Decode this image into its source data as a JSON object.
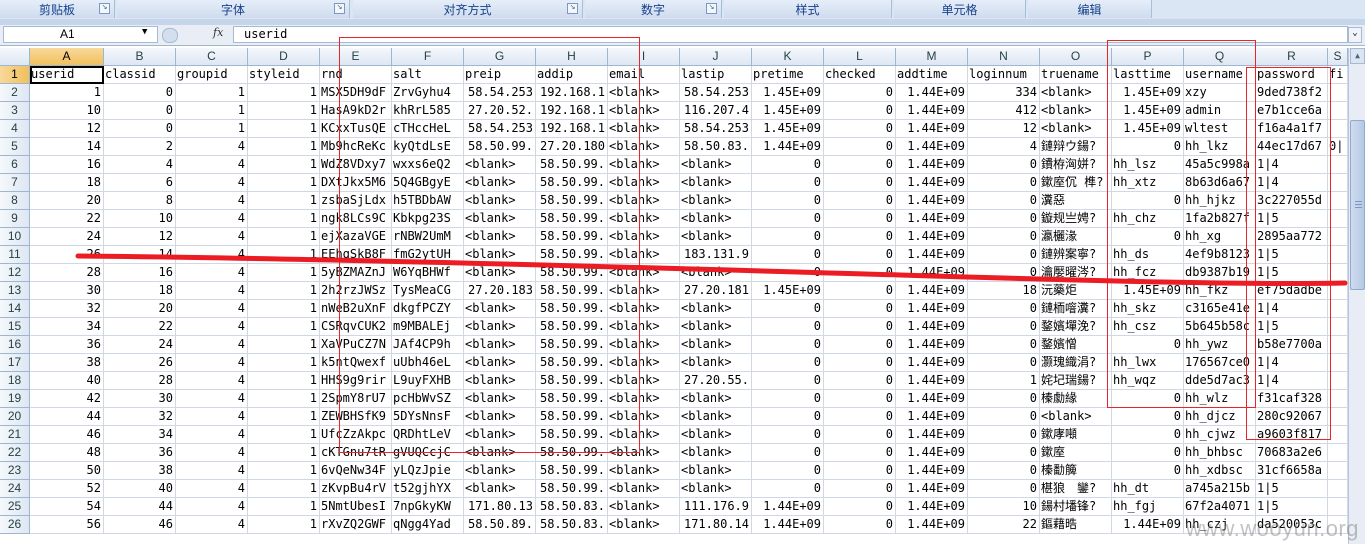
{
  "ribbon": {
    "groups": [
      "剪贴板",
      "字体",
      "对齐方式",
      "数字",
      "样式",
      "单元格",
      "编辑"
    ]
  },
  "formula_bar": {
    "name_box": "A1",
    "fx_label": "fx",
    "content": "userid"
  },
  "columns": [
    "A",
    "B",
    "C",
    "D",
    "E",
    "F",
    "G",
    "H",
    "I",
    "J",
    "K",
    "L",
    "M",
    "N",
    "O",
    "P",
    "Q",
    "R",
    "S"
  ],
  "rows": [
    [
      "userid",
      "classid",
      "groupid",
      "styleid",
      "rnd",
      "salt",
      "preip",
      "addip",
      "email",
      "lastip",
      "pretime",
      "checked",
      "addtime",
      "loginnum",
      "truename",
      "lasttime",
      "username",
      "password",
      "fi"
    ],
    [
      "1",
      "0",
      "1",
      "1",
      "MSX5DH9dF",
      "ZrvGyhu4",
      "58.54.253",
      "192.168.1",
      "<blank>",
      "58.54.253",
      "1.45E+09",
      "0",
      "1.44E+09",
      "334",
      "<blank>",
      "1.45E+09",
      "xzy",
      "9ded738f2",
      ""
    ],
    [
      "10",
      "0",
      "1",
      "1",
      "HasA9kD2r",
      "khRrL585",
      "27.20.52.",
      "192.168.1",
      "<blank>",
      "116.207.4",
      "1.45E+09",
      "0",
      "1.44E+09",
      "412",
      "<blank>",
      "1.45E+09",
      "admin",
      "e7b1cce6a",
      ""
    ],
    [
      "12",
      "0",
      "1",
      "1",
      "KCxxTusQE",
      "cTHccHeL",
      "58.54.253",
      "192.168.1",
      "<blank>",
      "58.54.253",
      "1.45E+09",
      "0",
      "1.44E+09",
      "12",
      "<blank>",
      "1.45E+09",
      "wltest",
      "f16a4a1f7",
      ""
    ],
    [
      "14",
      "2",
      "4",
      "1",
      "Mb9hcReKc",
      "kyQtdLsE",
      "58.50.99.",
      "27.20.180",
      "<blank>",
      "58.50.83.",
      "1.44E+09",
      "0",
      "1.44E+09",
      "4",
      "鏈辩ウ鍚?",
      "0",
      "hh_lkz",
      "44ec17d67",
      "0|"
    ],
    [
      "16",
      "4",
      "4",
      "1",
      "WdZ8VDxy7",
      "wxxs6eQ2",
      "<blank>",
      "58.50.99.",
      "<blank>",
      "<blank>",
      "0",
      "0",
      "1.44E+09",
      "0",
      "鐨栫洶姘?",
      "hh_lsz",
      "45a5c998a",
      "1|4",
      ""
    ],
    [
      "18",
      "6",
      "4",
      "1",
      "DXtJkx5M6",
      "5Q4GBgyE",
      "<blank>",
      "58.50.99.",
      "<blank>",
      "<blank>",
      "0",
      "0",
      "1.44E+09",
      "0",
      "鏉庢伔 榫?",
      "hh_xtz",
      "8b63d6a67",
      "1|4",
      ""
    ],
    [
      "20",
      "8",
      "4",
      "1",
      "zsbaSjLdx",
      "h5TBDbAW",
      "<blank>",
      "58.50.99.",
      "<blank>",
      "<blank>",
      "0",
      "0",
      "1.44E+09",
      "0",
      "瀵惡",
      "0",
      "hh_hjkz",
      "3c227055d",
      ""
    ],
    [
      "22",
      "10",
      "4",
      "1",
      "ngk8LCs9C",
      "Kbkpg23S",
      "<blank>",
      "58.50.99.",
      "<blank>",
      "<blank>",
      "0",
      "0",
      "1.44E+09",
      "0",
      "鏇规亗娉?",
      "hh_chz",
      "1fa2b827f",
      "1|5",
      ""
    ],
    [
      "24",
      "12",
      "4",
      "1",
      "ejXazaVGE",
      "rNBW2UmM",
      "<blank>",
      "58.50.99.",
      "<blank>",
      "<blank>",
      "0",
      "0",
      "1.44E+09",
      "0",
      "瀛欐湪",
      "0",
      "hh_xg",
      "2895aa772",
      ""
    ],
    [
      "26",
      "14",
      "4",
      "1",
      "EEhqSkB8F",
      "fmG2ytUH",
      "<blank>",
      "58.50.99.",
      "<blank>",
      "183.131.9",
      "0",
      "0",
      "1.44E+09",
      "0",
      "鏈辨案寧?",
      "hh_ds",
      "4ef9b8123",
      "1|5",
      ""
    ],
    [
      "28",
      "16",
      "4",
      "1",
      "5yBZMAZnJ",
      "W6YqBHWf",
      "<blank>",
      "58.50.99.",
      "<blank>",
      "<blank>",
      "0",
      "0",
      "1.44E+09",
      "0",
      "瀹嬮曜涔?",
      "hh_fcz",
      "db9387b19",
      "1|5",
      ""
    ],
    [
      "30",
      "18",
      "4",
      "1",
      "2h2rzJWSz",
      "TysMeaCG",
      "27.20.183",
      "58.50.99.",
      "<blank>",
      "27.20.181",
      "1.45E+09",
      "0",
      "1.44E+09",
      "18",
      "沅藥炬",
      "1.45E+09",
      "hh_fkz",
      "ef75dadbe",
      ""
    ],
    [
      "32",
      "20",
      "4",
      "1",
      "nWeB2uXnF",
      "dkgfPCZY",
      "<blank>",
      "58.50.99.",
      "<blank>",
      "<blank>",
      "0",
      "0",
      "1.44E+09",
      "0",
      "鏈栭噾瀵?",
      "hh_skz",
      "c3165e41e",
      "1|4",
      ""
    ],
    [
      "34",
      "22",
      "4",
      "1",
      "CSRqvCUK2",
      "m9MBALEj",
      "<blank>",
      "58.50.99.",
      "<blank>",
      "<blank>",
      "0",
      "0",
      "1.44E+09",
      "0",
      "鍪嬪墠浼?",
      "hh_csz",
      "5b645b58c",
      "1|5",
      ""
    ],
    [
      "36",
      "24",
      "4",
      "1",
      "XaVPuCZ7N",
      "JAf4CP9h",
      "<blank>",
      "58.50.99.",
      "<blank>",
      "<blank>",
      "0",
      "0",
      "1.44E+09",
      "0",
      "鍪嬪憎",
      "0",
      "hh_ywz",
      "b58e7700a",
      ""
    ],
    [
      "38",
      "26",
      "4",
      "1",
      "k5ntQwexf",
      "uUbh46eL",
      "<blank>",
      "58.50.99.",
      "<blank>",
      "<blank>",
      "0",
      "0",
      "1.44E+09",
      "0",
      "灏瑰織涓?",
      "hh_lwx",
      "176567ce0",
      "1|4",
      ""
    ],
    [
      "40",
      "28",
      "4",
      "1",
      "HHS9g9rir",
      "L9uyFXHB",
      "<blank>",
      "58.50.99.",
      "<blank>",
      "27.20.55.",
      "0",
      "0",
      "1.44E+09",
      "1",
      "姹圮瑞鍚?",
      "hh_wqz",
      "dde5d7ac3",
      "1|4",
      ""
    ],
    [
      "42",
      "30",
      "4",
      "1",
      "2SpmY8rU7",
      "pcHbWvSZ",
      "<blank>",
      "58.50.99.",
      "<blank>",
      "<blank>",
      "0",
      "0",
      "1.44E+09",
      "0",
      "榛勮緣",
      "0",
      "hh_wlz",
      "f31caf328",
      ""
    ],
    [
      "44",
      "32",
      "4",
      "1",
      "ZEWBHSfK9",
      "5DYsNnsF",
      "<blank>",
      "58.50.99.",
      "<blank>",
      "<blank>",
      "0",
      "0",
      "1.44E+09",
      "0",
      "<blank>",
      "0",
      "hh_djcz",
      "280c92067",
      ""
    ],
    [
      "46",
      "34",
      "4",
      "1",
      "UfcZzAkpc",
      "QRDhtLeV",
      "<blank>",
      "58.50.99.",
      "<blank>",
      "<blank>",
      "0",
      "0",
      "1.44E+09",
      "0",
      "鏉庨噸",
      "0",
      "hh_cjwz",
      "a9603f817",
      ""
    ],
    [
      "48",
      "36",
      "4",
      "1",
      "cKTGnu7tR",
      "gVUQCcjC",
      "<blank>",
      "58.50.99.",
      "<blank>",
      "<blank>",
      "0",
      "0",
      "1.44E+09",
      "0",
      "鏉庢",
      "0",
      "hh_bhbsc",
      "70683a2e6",
      ""
    ],
    [
      "50",
      "38",
      "4",
      "1",
      "6vQeNw34F",
      "yLQzJpie",
      "<blank>",
      "58.50.99.",
      "<blank>",
      "<blank>",
      "0",
      "0",
      "1.44E+09",
      "0",
      "榛勫簲",
      "0",
      "hh_xdbsc",
      "31cf6658a",
      ""
    ],
    [
      "52",
      "40",
      "4",
      "1",
      "zKvpBu4rV",
      "t52gjhYX",
      "<blank>",
      "58.50.99.",
      "<blank>",
      "<blank>",
      "0",
      "0",
      "1.44E+09",
      "0",
      "椹狼　鑾?",
      "hh_dt",
      "a745a215b",
      "1|5",
      ""
    ],
    [
      "54",
      "44",
      "4",
      "1",
      "5NmtUbesI",
      "7npGkyKW",
      "171.80.13",
      "58.50.83.",
      "<blank>",
      "111.176.9",
      "1.44E+09",
      "0",
      "1.44E+09",
      "10",
      "鍚村墦锋?",
      "hh_fgj",
      "67f2a4071",
      "1|5",
      ""
    ],
    [
      "56",
      "46",
      "4",
      "1",
      "rXvZQ2GWF",
      "qNgg4Yad",
      "58.50.89.",
      "58.50.83.",
      "<blank>",
      "171.80.14",
      "1.44E+09",
      "0",
      "1.44E+09",
      "22",
      "鏂藉晧",
      "1.44E+09",
      "hh_czj",
      "da520053c",
      ""
    ]
  ],
  "row_numbers": [
    "1",
    "2",
    "3",
    "4",
    "5",
    "6",
    "7",
    "8",
    "9",
    "10",
    "11",
    "12",
    "13",
    "14",
    "15",
    "16",
    "17",
    "18",
    "19",
    "20",
    "21",
    "22",
    "23",
    "24",
    "25",
    "26"
  ],
  "watermark": "www.wooyun.org",
  "annotation_color": "#e8262a"
}
